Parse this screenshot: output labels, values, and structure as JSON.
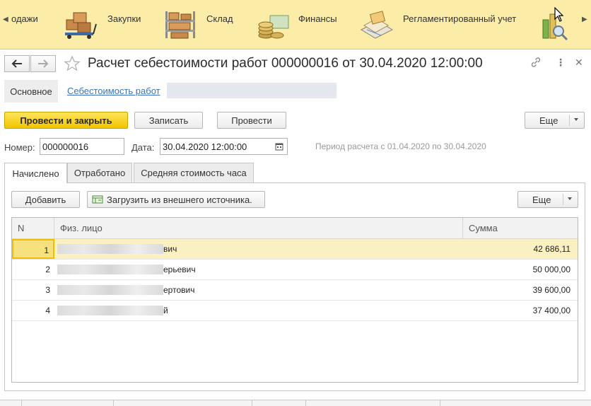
{
  "sections": {
    "items": [
      {
        "label": "одажи",
        "icon": "sales-icon"
      },
      {
        "label": "Закупки",
        "icon": "purchases-icon"
      },
      {
        "label": "Склад",
        "icon": "warehouse-icon"
      },
      {
        "label": "Финансы",
        "icon": "finance-icon"
      },
      {
        "label": "Регламентированный учет",
        "icon": "regulated-accounting-icon"
      },
      {
        "label": "",
        "icon": "analytics-icon"
      }
    ]
  },
  "form": {
    "title": "Расчет себестоимости работ 000000016 от 30.04.2020 12:00:00",
    "nav_tabs": {
      "main": "Основное",
      "cost": "Себестоимость работ"
    },
    "toolbar": {
      "post_close": "Провести и закрыть",
      "save": "Записать",
      "post": "Провести",
      "more": "Еще"
    },
    "fields": {
      "number_label": "Номер:",
      "number_value": "000000016",
      "date_label": "Дата:",
      "date_value": "30.04.2020 12:00:00"
    },
    "period_text": "Период расчета с 01.04.2020 по 30.04.2020",
    "tabs": [
      "Начислено",
      "Отработано",
      "Средняя стоимость часа"
    ],
    "table_toolbar": {
      "add": "Добавить",
      "load": "Загрузить из внешнего источника.",
      "more": "Еще"
    },
    "table": {
      "columns": [
        "N",
        "Физ. лицо",
        "Сумма"
      ],
      "rows": [
        {
          "n": "1",
          "person": "вич",
          "sum": "42 686,11",
          "selected": true
        },
        {
          "n": "2",
          "person": "ерьевич",
          "sum": "50 000,00"
        },
        {
          "n": "3",
          "person": "ертович",
          "sum": "39 600,00"
        },
        {
          "n": "4",
          "person": "й",
          "sum": "37 400,00"
        }
      ]
    }
  }
}
